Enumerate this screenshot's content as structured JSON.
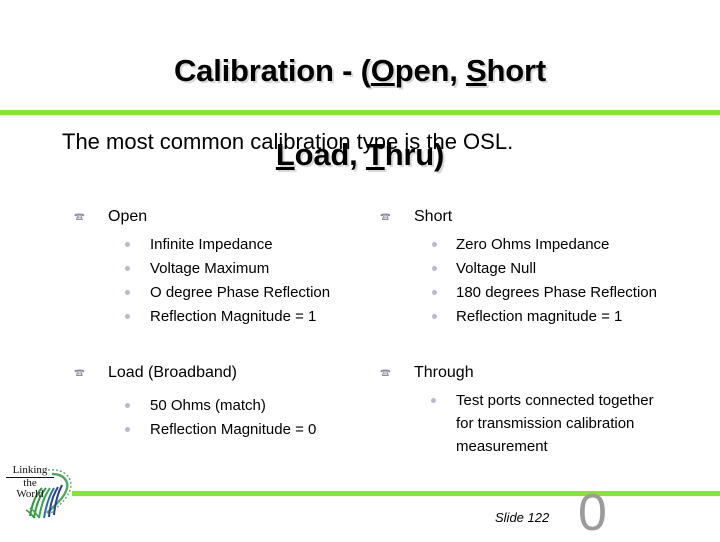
{
  "slide": {
    "title_line1": "Calibration - (Open, Short",
    "title_line2": "Load, Thru)",
    "title_plain": "Calibration - (Open, Short Load, Thru)",
    "subtitle": "The most common calibration type is the OSL.",
    "accent_color": "#80e830",
    "background_color": "#ffffff",
    "title_shadow_color": "#d8d8d8"
  },
  "columns": {
    "left": [
      {
        "lead": "Open",
        "bullet_icon": "wingding-b-bullet",
        "items": [
          "Infinite Impedance",
          "Voltage Maximum",
          "O degree Phase Reflection",
          "Reflection Magnitude = 1"
        ]
      },
      {
        "lead": "Load (Broadband)",
        "bullet_icon": "wingding-b-bullet",
        "items": [
          "50 Ohms (match)",
          "Reflection Magnitude = 0"
        ]
      }
    ],
    "right": [
      {
        "lead": "Short",
        "bullet_icon": "wingding-b-bullet",
        "items": [
          "Zero Ohms Impedance",
          "Voltage Null",
          "180 degrees Phase Reflection",
          "Reflection magnitude = 1"
        ]
      },
      {
        "lead": "Through",
        "bullet_icon": "wingding-b-bullet",
        "items_multiline": [
          [
            "Test ports connected together",
            "for transmission calibration",
            "measurement"
          ]
        ]
      }
    ]
  },
  "logo": {
    "line1": "Linking",
    "line2": "the",
    "line3": "World",
    "swoosh_green": "#2f9b3e",
    "swoosh_blue": "#2b3f94"
  },
  "footer": {
    "slide_label": "Slide 122",
    "page_number": "0",
    "page_number_color": "#9b9b9b"
  }
}
